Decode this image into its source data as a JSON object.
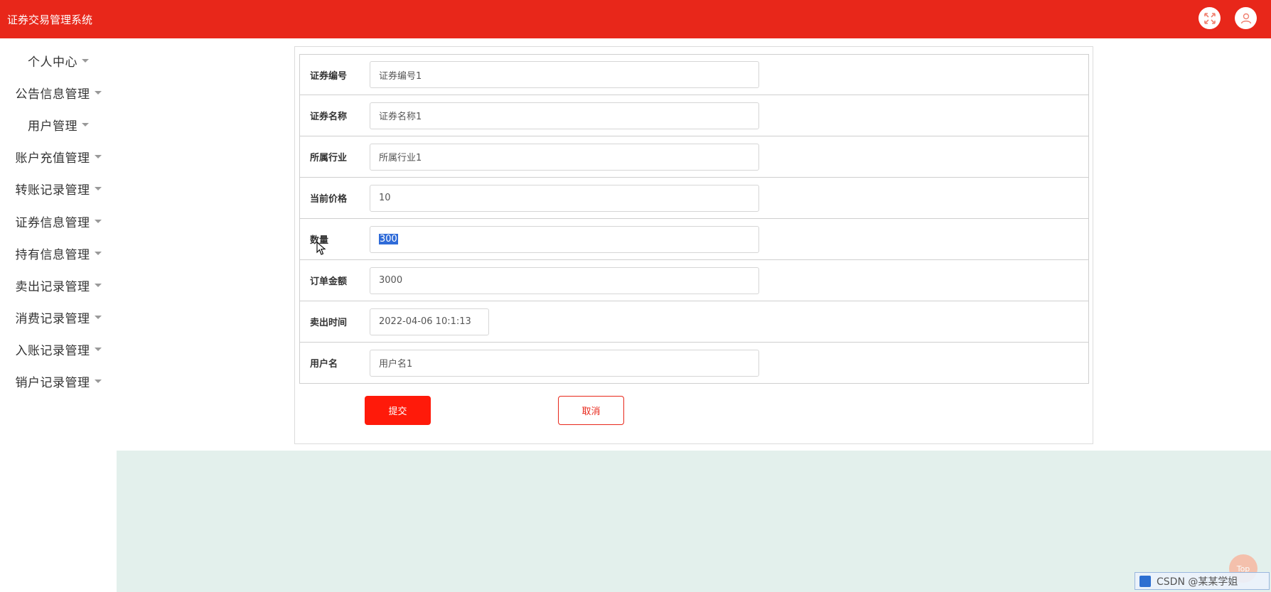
{
  "header": {
    "title": "证券交易管理系统",
    "fullscreen_icon": "fullscreen-icon",
    "user_icon": "user-icon"
  },
  "sidebar": {
    "items": [
      {
        "label": "个人中心"
      },
      {
        "label": "公告信息管理"
      },
      {
        "label": "用户管理"
      },
      {
        "label": "账户充值管理"
      },
      {
        "label": "转账记录管理"
      },
      {
        "label": "证券信息管理"
      },
      {
        "label": "持有信息管理"
      },
      {
        "label": "卖出记录管理"
      },
      {
        "label": "消费记录管理"
      },
      {
        "label": "入账记录管理"
      },
      {
        "label": "销户记录管理"
      }
    ]
  },
  "form": {
    "fields": [
      {
        "label": "证券编号",
        "value": "证券编号1"
      },
      {
        "label": "证券名称",
        "value": "证券名称1"
      },
      {
        "label": "所属行业",
        "value": "所属行业1"
      },
      {
        "label": "当前价格",
        "value": "10"
      },
      {
        "label": "数量",
        "value": "300"
      },
      {
        "label": "订单金额",
        "value": "3000"
      },
      {
        "label": "卖出时间",
        "value": "2022-04-06 10:1:13"
      },
      {
        "label": "用户名",
        "value": "用户名1"
      }
    ],
    "submit_label": "提交",
    "cancel_label": "取消"
  },
  "watermark": {
    "text": "CSDN @某某学姐"
  },
  "to_top": {
    "label": "Top"
  },
  "colors": {
    "brand": "#e8271a",
    "submit": "#ff1a0a",
    "lower_panel": "#e3f0ec"
  }
}
